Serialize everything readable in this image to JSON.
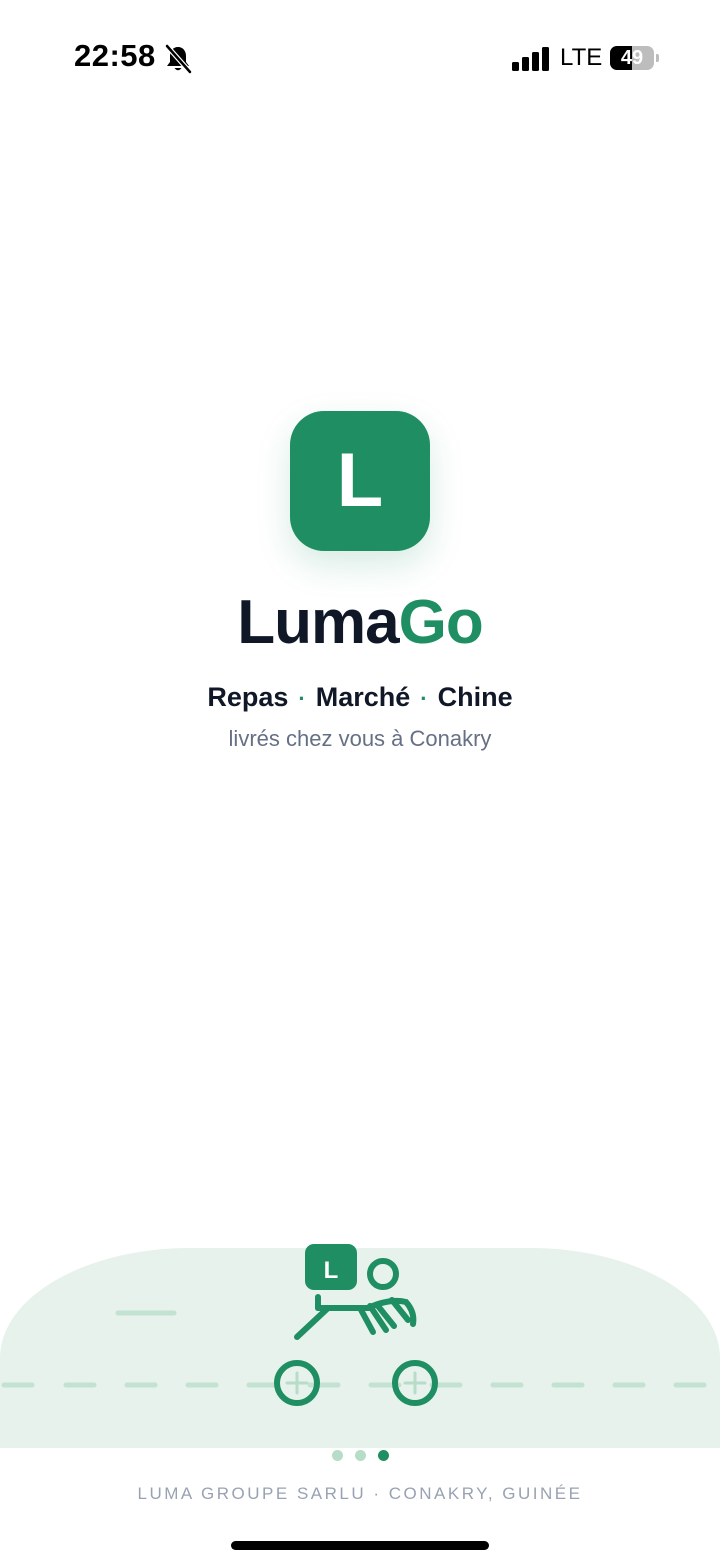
{
  "status_bar": {
    "time": "22:58",
    "mute_icon": "bell-slash-icon",
    "signal_icon": "cellular-signal-icon",
    "network": "LTE",
    "battery_level": "49",
    "battery_fraction": 0.49
  },
  "logo": {
    "letter": "L",
    "color": "#1f8e62"
  },
  "brand": {
    "part_a": "Luma",
    "part_b": "Go",
    "color_dark": "#101828",
    "color_accent": "#1f8e62"
  },
  "tagline": {
    "item_1": "Repas",
    "separator_1": "·",
    "item_2": "Marché",
    "separator_2": "·",
    "item_3": "Chine"
  },
  "subline": "livrés chez vous à Conakry",
  "illustration": {
    "icon": "delivery-scooter-icon",
    "box_letter": "L",
    "road_color": "#e6f2eb"
  },
  "pager": {
    "count": 3,
    "active_index": 2
  },
  "footer": "LUMA GROUPE SARLU · CONAKRY, GUINÉE"
}
